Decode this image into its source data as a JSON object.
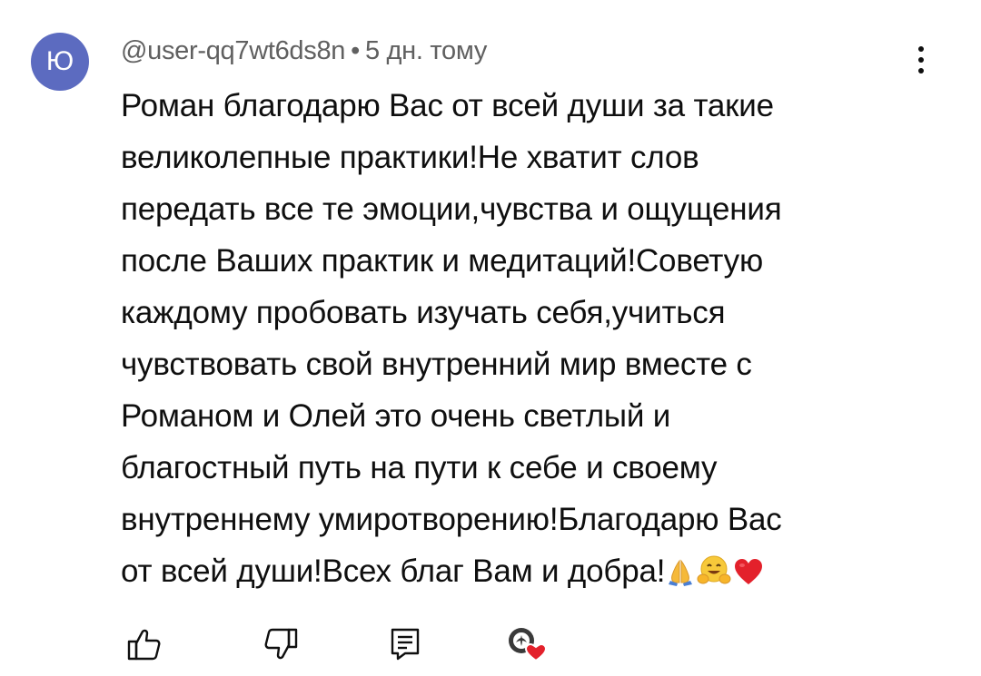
{
  "comment": {
    "author_initial": "Ю",
    "author_handle": "@user-qq7wt6ds8n",
    "separator": "•",
    "timestamp": "5 дн. тому",
    "avatar_color": "#5c6bc0",
    "text_lines": [
      "Роман благодарю Вас от всей души за такие",
      "великолепные практики!Не хватит слов",
      "передать все те эмоции,чувства и ощущения",
      "после Ваших практик и медитаций!Советую",
      "каждому пробовать изучать себя,учиться",
      "чувствовать свой внутренний мир вместе с",
      "Романом и Олей это очень светлый и",
      "благостный путь на пути к себе и своему",
      "внутреннему умиротворению!Благодарю Вас",
      "от всей души!Всех благ Вам и добра!"
    ],
    "emojis": [
      "folded-hands",
      "hugging-face",
      "red-heart"
    ]
  },
  "actions": {
    "like_icon": "thumbs-up-icon",
    "dislike_icon": "thumbs-down-icon",
    "reply_icon": "reply-comment-icon",
    "creator_heart_icon": "creator-heart-icon"
  },
  "menu": {
    "icon": "more-vertical-icon"
  }
}
